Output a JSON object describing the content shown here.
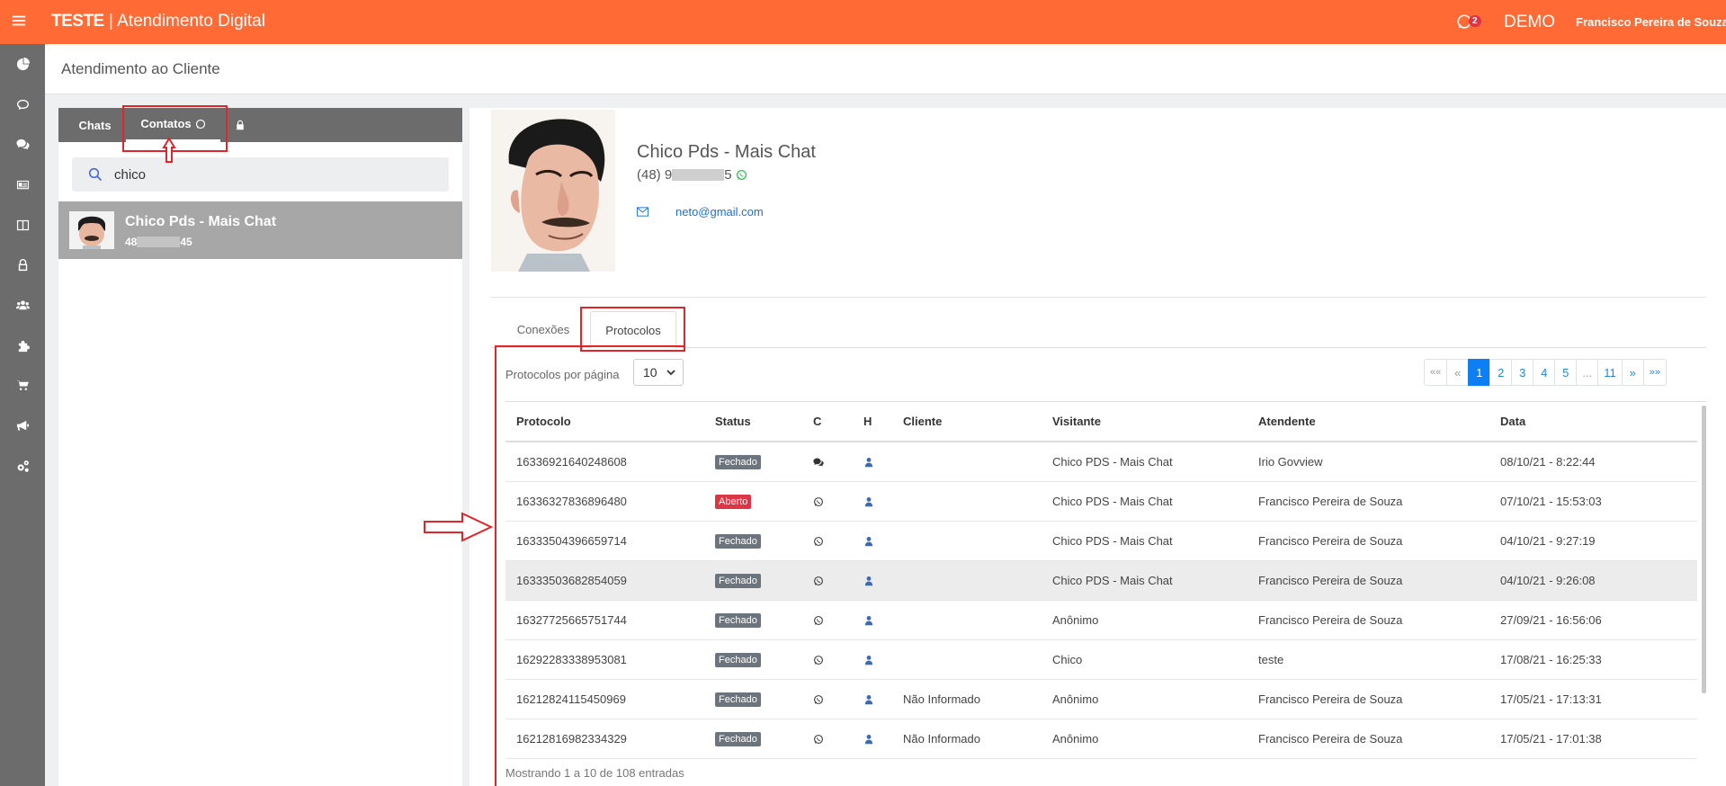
{
  "topbar": {
    "brand_bold": "TESTE",
    "brand_rest": " | Atendimento Digital",
    "whatsapp_badge": "2",
    "env": "DEMO",
    "user_name": "Francisco Pereira de Souza"
  },
  "sidebar": {
    "icons": [
      "pie-chart",
      "chat-bubble",
      "chat-bubbles",
      "id-card",
      "columns",
      "lock",
      "users",
      "puzzle",
      "cart",
      "megaphone",
      "gears"
    ]
  },
  "page": {
    "title": "Atendimento ao Cliente"
  },
  "left": {
    "tabs": {
      "chats": "Chats",
      "contatos": "Contatos"
    },
    "search": {
      "value": "chico",
      "placeholder": ""
    },
    "contact": {
      "name": "Chico Pds - Mais Chat",
      "phone_start": "48",
      "phone_end": "45"
    }
  },
  "profile": {
    "name": "Chico Pds - Mais Chat",
    "phone_start": "(48) 9",
    "phone_end": "5",
    "email_end": "neto@gmail.com"
  },
  "tabs": {
    "conexoes": "Conexões",
    "protocolos": "Protocolos"
  },
  "table_controls": {
    "per_page_label": "Protocolos por página",
    "per_page_value": "10",
    "pagination": [
      "««",
      "«",
      "1",
      "2",
      "3",
      "4",
      "5",
      "...",
      "11",
      "»",
      "»»"
    ],
    "current_page": "1"
  },
  "table": {
    "columns": [
      "Protocolo",
      "Status",
      "C",
      "H",
      "Cliente",
      "Visitante",
      "Atendente",
      "Data"
    ],
    "rows": [
      {
        "protocolo": "16336921640248608",
        "status": "Fechado",
        "c": "chat",
        "cliente": "",
        "visitante": "Chico PDS - Mais Chat",
        "atendente": "Irio Govview",
        "data": "08/10/21 - 8:22:44"
      },
      {
        "protocolo": "16336327836896480",
        "status": "Aberto",
        "c": "whatsapp",
        "cliente": "",
        "visitante": "Chico PDS - Mais Chat",
        "atendente": "Francisco Pereira de Souza",
        "data": "07/10/21 - 15:53:03"
      },
      {
        "protocolo": "16333504396659714",
        "status": "Fechado",
        "c": "whatsapp",
        "cliente": "",
        "visitante": "Chico PDS - Mais Chat",
        "atendente": "Francisco Pereira de Souza",
        "data": "04/10/21 - 9:27:19"
      },
      {
        "protocolo": "16333503682854059",
        "status": "Fechado",
        "c": "whatsapp",
        "cliente": "",
        "visitante": "Chico PDS - Mais Chat",
        "atendente": "Francisco Pereira de Souza",
        "data": "04/10/21 - 9:26:08"
      },
      {
        "protocolo": "16327725665751744",
        "status": "Fechado",
        "c": "whatsapp",
        "cliente": "",
        "visitante": "Anônimo",
        "atendente": "Francisco Pereira de Souza",
        "data": "27/09/21 - 16:56:06"
      },
      {
        "protocolo": "16292283338953081",
        "status": "Fechado",
        "c": "whatsapp",
        "cliente": "",
        "visitante": "Chico",
        "atendente": "teste",
        "data": "17/08/21 - 16:25:33"
      },
      {
        "protocolo": "16212824115450969",
        "status": "Fechado",
        "c": "whatsapp",
        "cliente": "Não Informado",
        "visitante": "Anônimo",
        "atendente": "Francisco Pereira de Souza",
        "data": "17/05/21 - 17:13:31"
      },
      {
        "protocolo": "16212816982334329",
        "status": "Fechado",
        "c": "whatsapp",
        "cliente": "Não Informado",
        "visitante": "Anônimo",
        "atendente": "Francisco Pereira de Souza",
        "data": "17/05/21 - 17:01:38"
      }
    ]
  },
  "footer": {
    "info": "Mostrando 1 a 10 de 108 entradas"
  },
  "colors": {
    "topbar": "#ff6a35",
    "sidebar": "#6c6c6c",
    "active_page": "#0d7ff4",
    "status_open": "#dc3545",
    "status_closed": "#6c757d",
    "annotation": "#e0262a"
  }
}
